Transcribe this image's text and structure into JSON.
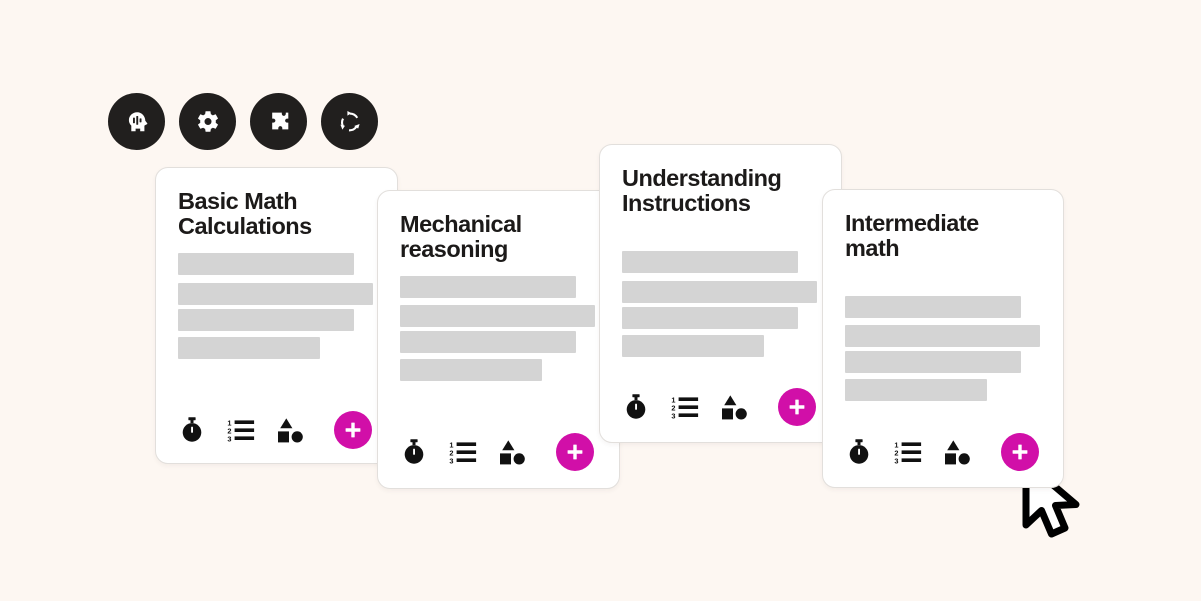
{
  "background_color": "#FDF7F2",
  "accent_color": "#D10FA8",
  "dark_color": "#211F1E",
  "placeholder_color": "#D4D4D4",
  "icon_row": {
    "items": [
      {
        "name": "head-profile-icon",
        "label": "Cognitive"
      },
      {
        "name": "gear-icon",
        "label": "Settings"
      },
      {
        "name": "puzzle-piece-icon",
        "label": "Puzzle"
      },
      {
        "name": "recycle-arrows-icon",
        "label": "Refresh"
      }
    ]
  },
  "cards": [
    {
      "title": "Basic Math\nCalculations",
      "lines": [
        176,
        195,
        176,
        142
      ],
      "tools": [
        {
          "name": "stopwatch-icon",
          "label": "Timer"
        },
        {
          "name": "numbered-list-icon",
          "label": "Questions"
        },
        {
          "name": "shapes-icon",
          "label": "Categories"
        }
      ],
      "add_label": "+"
    },
    {
      "title": "Mechanical\nreasoning",
      "lines": [
        176,
        195,
        176,
        142
      ],
      "tools": [
        {
          "name": "stopwatch-icon",
          "label": "Timer"
        },
        {
          "name": "numbered-list-icon",
          "label": "Questions"
        },
        {
          "name": "shapes-icon",
          "label": "Categories"
        }
      ],
      "add_label": "+"
    },
    {
      "title": "Understanding\nInstructions",
      "lines": [
        176,
        195,
        176,
        142
      ],
      "tools": [
        {
          "name": "stopwatch-icon",
          "label": "Timer"
        },
        {
          "name": "numbered-list-icon",
          "label": "Questions"
        },
        {
          "name": "shapes-icon",
          "label": "Categories"
        }
      ],
      "add_label": "+"
    },
    {
      "title": "Intermediate\nmath",
      "lines": [
        176,
        195,
        176,
        142
      ],
      "tools": [
        {
          "name": "stopwatch-icon",
          "label": "Timer"
        },
        {
          "name": "numbered-list-icon",
          "label": "Questions"
        },
        {
          "name": "shapes-icon",
          "label": "Categories"
        }
      ],
      "add_label": "+"
    }
  ],
  "cursor": {
    "name": "mouse-pointer"
  }
}
